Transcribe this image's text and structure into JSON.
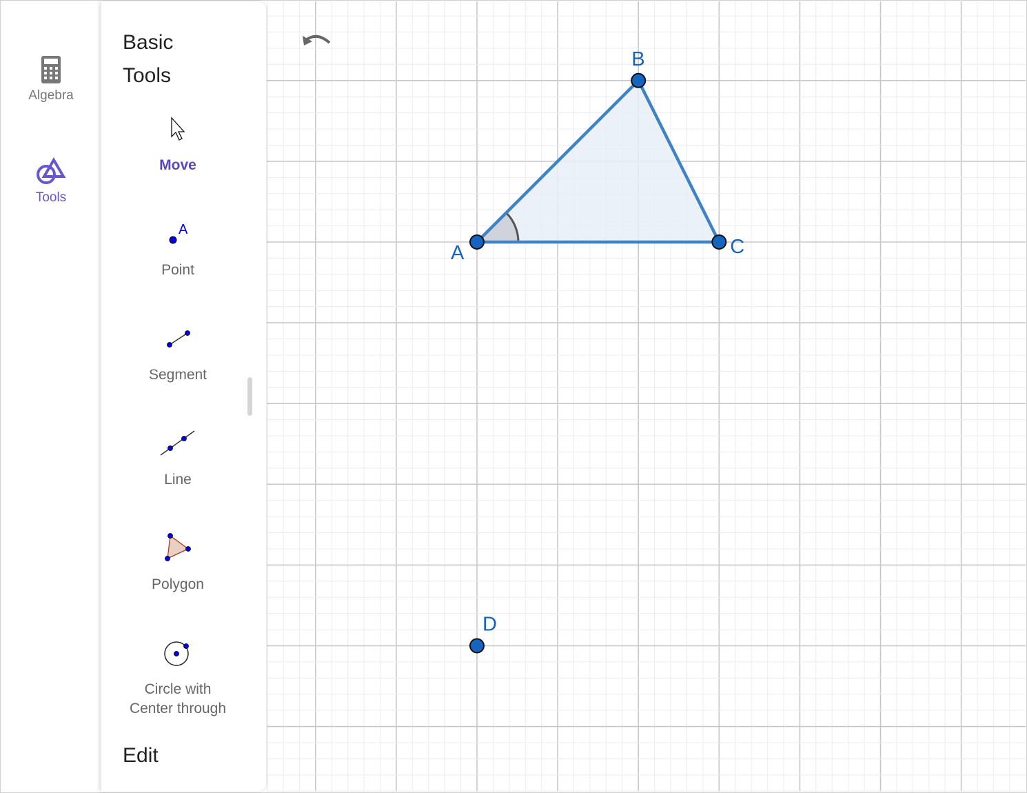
{
  "rail": {
    "items": [
      {
        "label": "Algebra",
        "icon": "calculator-icon",
        "active": false
      },
      {
        "label": "Tools",
        "icon": "tools-shapes-icon",
        "active": true
      }
    ],
    "active_color": "#6557d2",
    "inactive_color": "#777777"
  },
  "panel": {
    "title_line1": "Basic",
    "title_line2": "Tools",
    "tools": [
      {
        "label": "Move",
        "icon": "cursor-arrow-icon",
        "active": true
      },
      {
        "label": "Point",
        "icon": "point-icon"
      },
      {
        "label": "Segment",
        "icon": "segment-icon"
      },
      {
        "label": "Line",
        "icon": "line-icon"
      },
      {
        "label": "Polygon",
        "icon": "polygon-icon"
      },
      {
        "label_line1": "Circle with",
        "label_line2": "Center through",
        "icon": "circle-center-point-icon"
      }
    ],
    "edit_label": "Edit"
  },
  "toolbar": {
    "undo_icon": "undo-icon"
  },
  "graphics": {
    "points": [
      {
        "name": "A",
        "x": 0,
        "y": 0
      },
      {
        "name": "B",
        "x": 2,
        "y": 2
      },
      {
        "name": "C",
        "x": 3,
        "y": 0
      },
      {
        "name": "D",
        "x": 0,
        "y": -5
      }
    ],
    "polygon": [
      "A",
      "B",
      "C"
    ],
    "angle_at": "A",
    "point_color": "#1565c0",
    "line_color": "#3f82c8",
    "fill_color": "#e6eef8",
    "grid": true
  }
}
